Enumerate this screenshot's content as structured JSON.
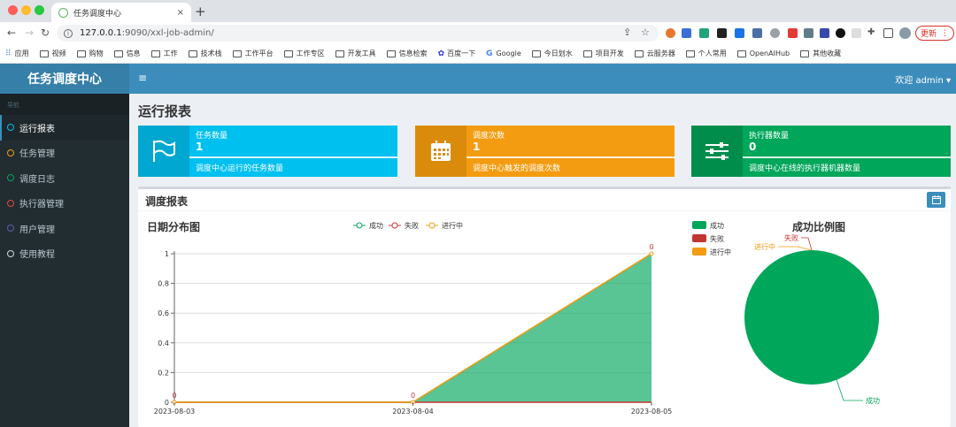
{
  "browser": {
    "tab_title": "任务调度中心",
    "tab_close": "×",
    "new_tab": "+",
    "url_host": "127.0.0.1",
    "url_rest": ":9090/xxl-job-admin/",
    "update_label": "更新",
    "bookmarks": [
      "应用",
      "视频",
      "购物",
      "信息",
      "工作",
      "技术栈",
      "工作平台",
      "工作专区",
      "开发工具",
      "信息检索",
      "百度一下",
      "Google",
      "今日划水",
      "项目开发",
      "云服务器",
      "个人常用",
      "OpenAIHub",
      "其他收藏"
    ]
  },
  "app": {
    "logo": "任务调度中心",
    "welcome": "欢迎 admin ▾",
    "nav_header": "导航",
    "menu": [
      {
        "label": "运行报表",
        "color": "#00c0ef",
        "active": true
      },
      {
        "label": "任务管理",
        "color": "#f39c12"
      },
      {
        "label": "调度日志",
        "color": "#00a65a"
      },
      {
        "label": "执行器管理",
        "color": "#dd4b39"
      },
      {
        "label": "用户管理",
        "color": "#605ca8"
      },
      {
        "label": "使用教程",
        "color": "#d2d6de"
      }
    ],
    "page_title": "运行报表"
  },
  "infoboxes": [
    {
      "label": "任务数量",
      "value": "1",
      "desc": "调度中心运行的任务数量",
      "icon": "flag-icon",
      "bg": "#00c0ef",
      "icon_bg": "#00a7d0"
    },
    {
      "label": "调度次数",
      "value": "1",
      "desc": "调度中心触发的调度次数",
      "icon": "calendar-icon",
      "bg": "#f39c12",
      "icon_bg": "#db8b0b"
    },
    {
      "label": "执行器数量",
      "value": "0",
      "desc": "调度中心在线的执行器机器数量",
      "icon": "sliders-icon",
      "bg": "#00a65a",
      "icon_bg": "#008d4c"
    }
  ],
  "report": {
    "box_title": "调度报表"
  },
  "chart_data": [
    {
      "type": "area",
      "title": "日期分布图",
      "x": [
        "2023-08-03",
        "2023-08-04",
        "2023-08-05"
      ],
      "series": [
        {
          "name": "成功",
          "values": [
            0,
            0,
            1
          ],
          "color": "#00a65a"
        },
        {
          "name": "失败",
          "values": [
            0,
            0,
            0
          ],
          "color": "#c23632"
        },
        {
          "name": "进行中",
          "values": [
            0,
            0,
            0
          ],
          "color": "#f39c12"
        }
      ],
      "data_labels": [
        "0",
        "0",
        "0"
      ],
      "yticks": [
        "0",
        "0.2",
        "0.4",
        "0.6",
        "0.8",
        "1"
      ],
      "ylim": [
        0,
        1
      ],
      "legend": "top-center"
    },
    {
      "type": "pie",
      "title": "成功比例图",
      "series": [
        {
          "name": "成功",
          "value": 1,
          "color": "#00a65a"
        },
        {
          "name": "失败",
          "value": 0,
          "color": "#c23632"
        },
        {
          "name": "进行中",
          "value": 0,
          "color": "#f39c12"
        }
      ],
      "legend": "top-left"
    }
  ]
}
